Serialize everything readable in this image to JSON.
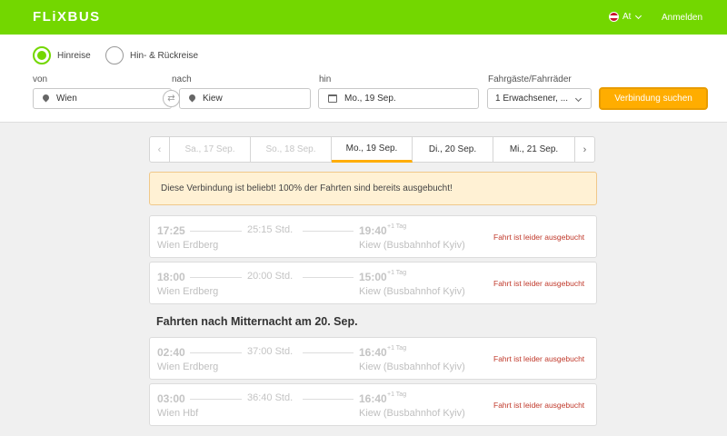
{
  "header": {
    "logo": "FLiXBUS",
    "language": "At",
    "login": "Anmelden"
  },
  "search": {
    "trip_type": {
      "oneway_label": "Hinreise",
      "roundtrip_label": "Hin- & Rückreise",
      "selected": "Hinreise"
    },
    "from_label": "von",
    "from_value": "Wien",
    "to_label": "nach",
    "to_value": "Kiew",
    "date_label": "hin",
    "date_value": "Mo., 19 Sep.",
    "passengers_label": "Fahrgäste/Fahrräder",
    "passengers_value": "1 Erwachsener, ...",
    "search_button": "Verbindung suchen"
  },
  "dates": [
    {
      "label": "Sa., 17 Sep.",
      "state": "disabled"
    },
    {
      "label": "So., 18 Sep.",
      "state": "disabled"
    },
    {
      "label": "Mo., 19 Sep.",
      "state": "active"
    },
    {
      "label": "Di., 20 Sep.",
      "state": "normal"
    },
    {
      "label": "Mi., 21 Sep.",
      "state": "normal"
    }
  ],
  "alert": "Diese Verbindung ist beliebt! 100% der Fahrten sind bereits ausgebucht!",
  "rides_group1": [
    {
      "dep_time": "17:25",
      "duration": "25:15 Std.",
      "arr_time": "19:40",
      "day_plus": "+1 Tag",
      "from": "Wien Erdberg",
      "to": "Kiew (Busbahnhof Kyiv)",
      "status": "Fahrt ist leider ausgebucht"
    },
    {
      "dep_time": "18:00",
      "duration": "20:00 Std.",
      "arr_time": "15:00",
      "day_plus": "+1 Tag",
      "from": "Wien Erdberg",
      "to": "Kiew (Busbahnhof Kyiv)",
      "status": "Fahrt ist leider ausgebucht"
    }
  ],
  "after_midnight_heading": "Fahrten nach Mitternacht am 20. Sep.",
  "rides_group2": [
    {
      "dep_time": "02:40",
      "duration": "37:00 Std.",
      "arr_time": "16:40",
      "day_plus": "+1 Tag",
      "from": "Wien Erdberg",
      "to": "Kiew (Busbahnhof Kyiv)",
      "status": "Fahrt ist leider ausgebucht"
    },
    {
      "dep_time": "03:00",
      "duration": "36:40 Std.",
      "arr_time": "16:40",
      "day_plus": "+1 Tag",
      "from": "Wien Hbf",
      "to": "Kiew (Busbahnhof Kyiv)",
      "status": "Fahrt ist leider ausgebucht"
    }
  ]
}
